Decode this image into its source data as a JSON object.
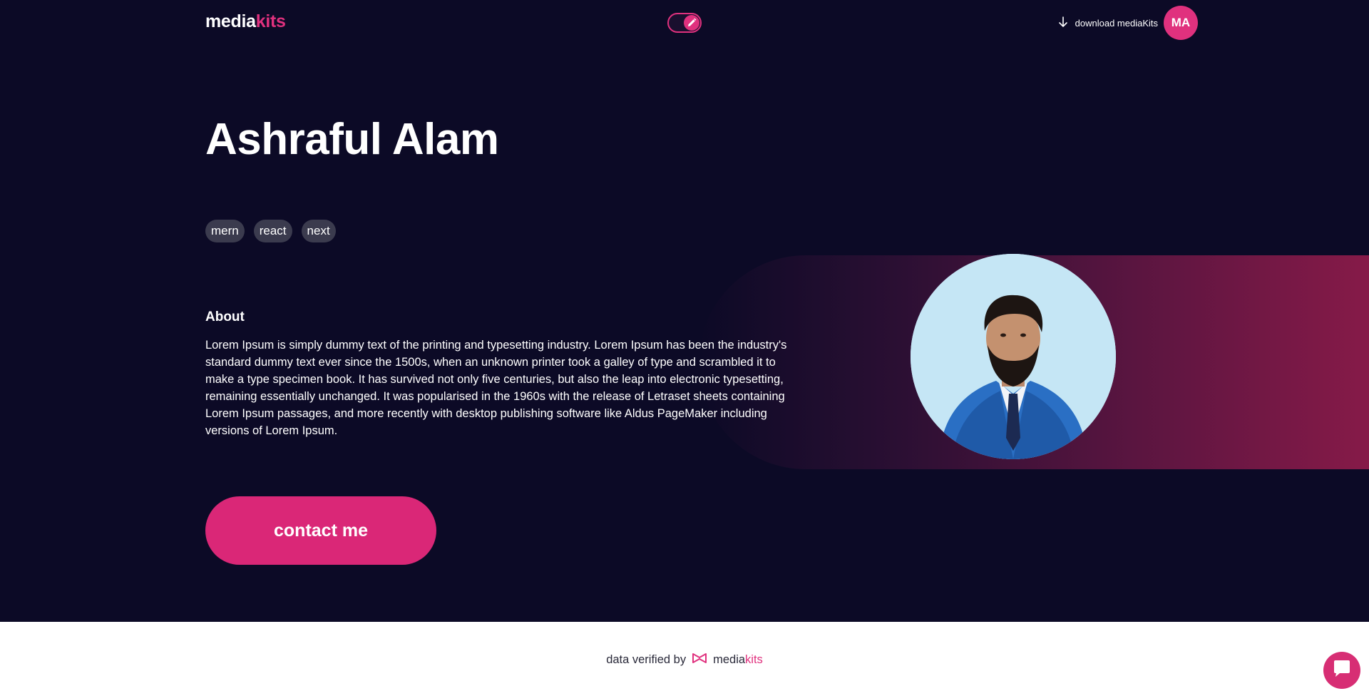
{
  "header": {
    "logo_part1": "media",
    "logo_part2": "kits",
    "toggle_icon": "pencil-icon",
    "download_label": "download mediaKits",
    "download_icon": "arrow-down-icon",
    "avatar_initials": "MA"
  },
  "profile": {
    "name": "Ashraful Alam",
    "tags": [
      "mern",
      "react",
      "next"
    ],
    "about_title": "About",
    "about_text": "Lorem Ipsum is simply dummy text of the printing and typesetting industry. Lorem Ipsum has been the industry's standard dummy text ever since the 1500s, when an unknown printer took a galley of type and scrambled it to make a type specimen book. It has survived not only five centuries, but also the leap into electronic typesetting, remaining essentially unchanged. It was popularised in the 1960s with the release of Letraset sheets containing Lorem Ipsum passages, and more recently with desktop publishing software like Aldus PageMaker including versions of Lorem Ipsum.",
    "contact_label": "contact me"
  },
  "footer": {
    "verified_label": "data verified by",
    "brand_part1": "media",
    "brand_part2": "kits",
    "chat_icon": "chat-bubble-icon"
  },
  "colors": {
    "background": "#0c0a26",
    "accent": "#e0317e",
    "tag_bg": "#3b3b4e",
    "footer_bg": "#ffffff"
  }
}
